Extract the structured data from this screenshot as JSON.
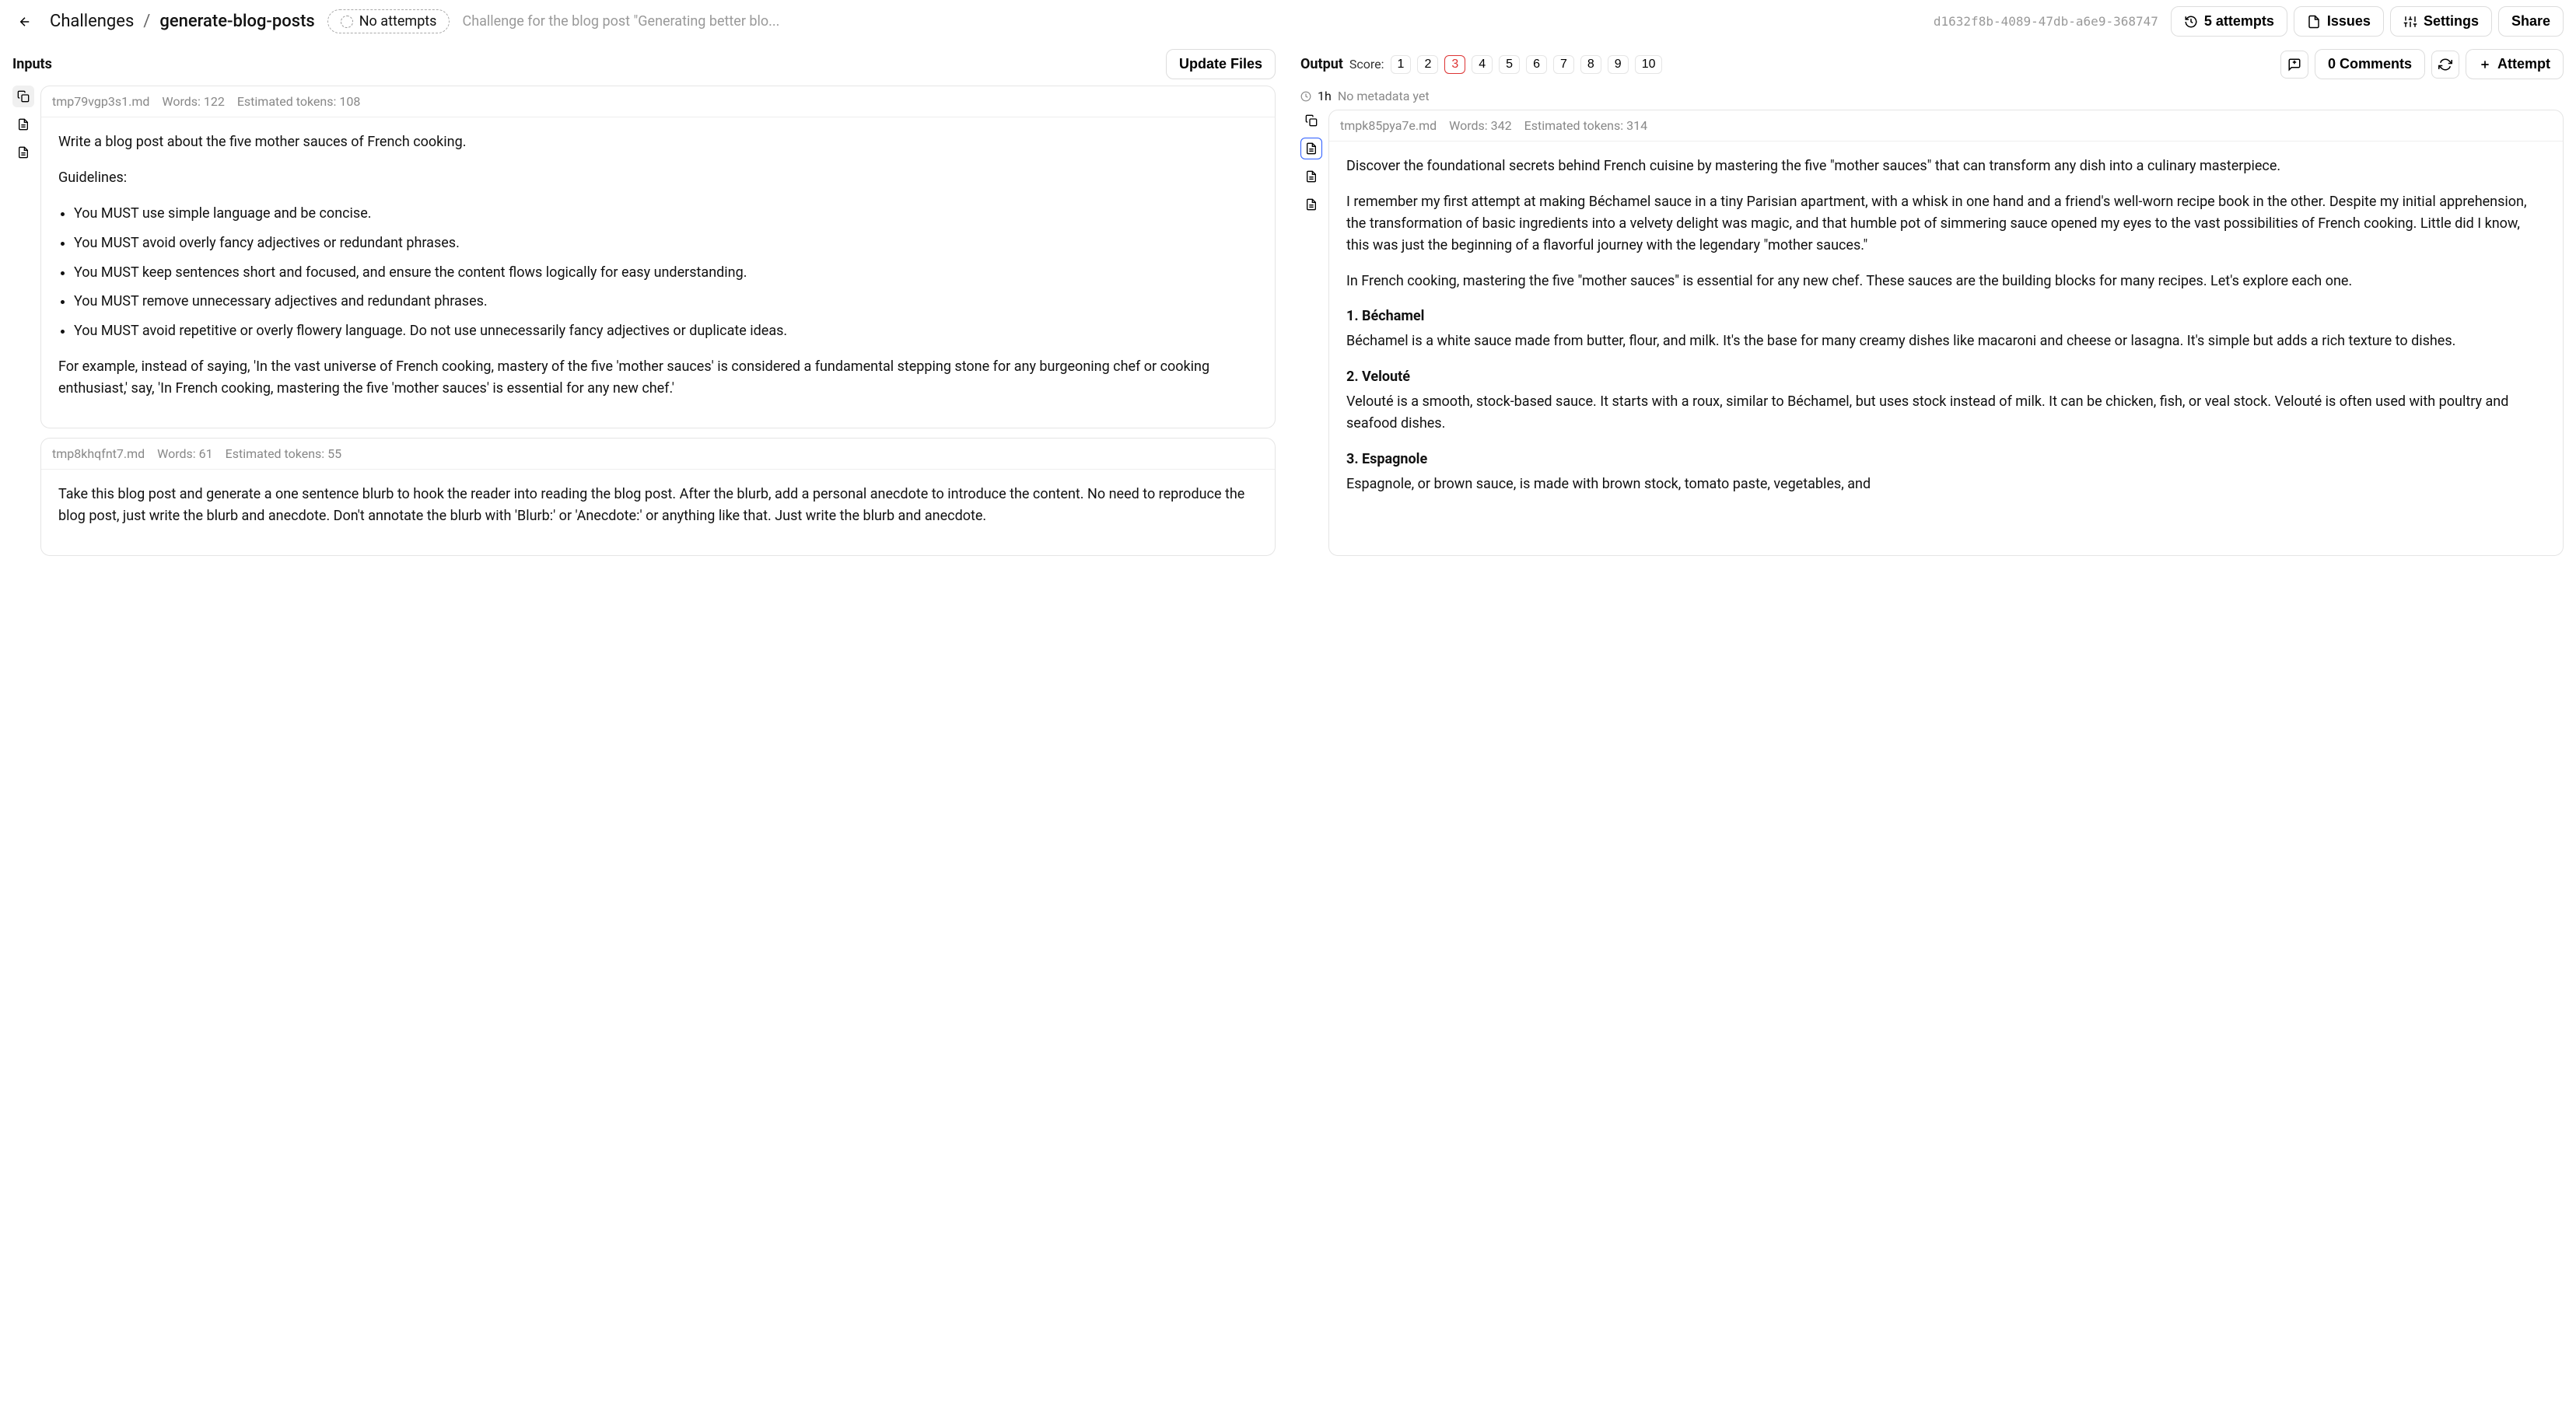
{
  "header": {
    "breadcrumb": [
      "Challenges",
      "generate-blog-posts"
    ],
    "attempts_pill": "No attempts",
    "description": "Challenge for the blog post \"Generating better blo...",
    "hash": "d1632f8b-4089-47db-a6e9-368747",
    "actions": {
      "attempts": "5 attempts",
      "issues": "Issues",
      "settings": "Settings",
      "share": "Share"
    }
  },
  "inputs_panel": {
    "title": "Inputs",
    "update_btn": "Update Files",
    "files": [
      {
        "name": "tmp79vgp3s1.md",
        "words": "Words: 122",
        "tokens": "Estimated tokens: 108",
        "lead": "Write a blog post about the five mother sauces of French cooking.",
        "guidelines_h": "Guidelines:",
        "bullets": [
          "You MUST use simple language and be concise.",
          "You MUST avoid overly fancy adjectives or redundant phrases.",
          "You MUST keep sentences short and focused, and ensure the content flows logically for easy understanding.",
          "You MUST remove unnecessary adjectives and redundant phrases.",
          "You MUST avoid repetitive or overly flowery language. Do not use unnecessarily fancy adjectives or duplicate ideas."
        ],
        "example": "For example, instead of saying, 'In the vast universe of French cooking, mastery of the five 'mother sauces' is considered a fundamental stepping stone for any burgeoning chef or cooking enthusiast,' say, 'In French cooking, mastering the five 'mother sauces' is essential for any new chef.'"
      },
      {
        "name": "tmp8khqfnt7.md",
        "words": "Words: 61",
        "tokens": "Estimated tokens: 55",
        "body": "Take this blog post and generate a one sentence blurb to hook the reader into reading the blog post. After the blurb, add a personal anecdote to introduce the content. No need to reproduce the blog post, just write the blurb and anecdote. Don't annotate the blurb with 'Blurb:' or 'Anecdote:' or anything like that. Just write the blurb and anecdote."
      }
    ]
  },
  "output_panel": {
    "title": "Output",
    "score_label": "Score:",
    "scores": [
      "1",
      "2",
      "3",
      "4",
      "5",
      "6",
      "7",
      "8",
      "9",
      "10"
    ],
    "active_score": "3",
    "comments_btn": "0 Comments",
    "attempt_btn": "Attempt",
    "meta_time": "1h",
    "meta_text": "No metadata yet",
    "file": {
      "name": "tmpk85pya7e.md",
      "words": "Words: 342",
      "tokens": "Estimated tokens: 314",
      "p1": "Discover the foundational secrets behind French cuisine by mastering the five \"mother sauces\" that can transform any dish into a culinary masterpiece.",
      "p2": "I remember my first attempt at making Béchamel sauce in a tiny Parisian apartment, with a whisk in one hand and a friend's well-worn recipe book in the other. Despite my initial apprehension, the transformation of basic ingredients into a velvety delight was magic, and that humble pot of simmering sauce opened my eyes to the vast possibilities of French cooking. Little did I know, this was just the beginning of a flavorful journey with the legendary \"mother sauces.\"",
      "p3": "In French cooking, mastering the five \"mother sauces\" is essential for any new chef. These sauces are the building blocks for many recipes. Let's explore each one.",
      "s1h": "1. Béchamel",
      "s1p": "Béchamel is a white sauce made from butter, flour, and milk. It's the base for many creamy dishes like macaroni and cheese or lasagna. It's simple but adds a rich texture to dishes.",
      "s2h": "2. Velouté",
      "s2p": "Velouté is a smooth, stock-based sauce. It starts with a roux, similar to Béchamel, but uses stock instead of milk. It can be chicken, fish, or veal stock. Velouté is often used with poultry and seafood dishes.",
      "s3h": "3. Espagnole",
      "s3p": "Espagnole, or brown sauce, is made with brown stock, tomato paste, vegetables, and"
    }
  }
}
